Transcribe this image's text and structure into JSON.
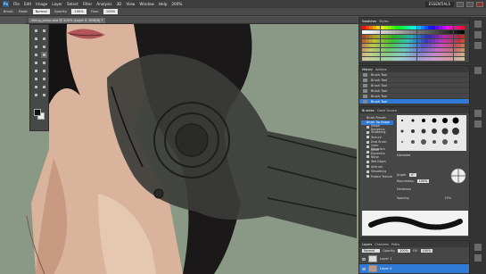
{
  "app": {
    "logo": "Ps",
    "menu": [
      "File",
      "Edit",
      "Image",
      "Layer",
      "Select",
      "Filter",
      "Analysis",
      "3D",
      "View",
      "Window",
      "Help"
    ],
    "workspace": "ESSENTIALS",
    "zoom": "200%"
  },
  "options": {
    "tool_label": "Brush:",
    "mode_label": "Mode:",
    "mode_value": "Normal",
    "opacity_label": "Opacity:",
    "opacity_value": "100%",
    "flow_label": "Flow:",
    "flow_value": "100%"
  },
  "document": {
    "tab_title": "viking_pinup.psd @ 200% (Layer 0, RGB/8) *"
  },
  "panels": {
    "swatches_tabs": [
      "Swatches",
      "Styles"
    ],
    "history_tabs": [
      "History",
      "Actions"
    ],
    "history_items": [
      "Brush Tool",
      "Brush Tool",
      "Brush Tool",
      "Brush Tool",
      "Brush Tool",
      "Brush Tool"
    ],
    "brushes_tabs": [
      "Brushes",
      "Clone Source"
    ],
    "brush_presets_label": "Brush Presets",
    "brush_options": [
      "Brush Tip Shape",
      "Shape Dynamics",
      "Scattering",
      "Texture",
      "Dual Brush",
      "Color Dynamics",
      "Other Dynamics",
      "Noise",
      "Wet Edges",
      "Airbrush",
      "Smoothing",
      "Protect Texture"
    ],
    "brush_diameter_label": "Diameter",
    "brush_angle_label": "Angle:",
    "brush_angle": "0°",
    "brush_roundness_label": "Roundness:",
    "brush_roundness": "100%",
    "brush_hardness_label": "Hardness",
    "brush_spacing_label": "Spacing",
    "brush_spacing": "25%",
    "layers_tabs": [
      "Layers",
      "Channels",
      "Paths"
    ],
    "blend_mode": "Normal",
    "layer_opacity_label": "Opacity:",
    "layer_opacity": "100%",
    "fill_label": "Fill:",
    "fill_value": "100%",
    "layers": [
      "Layer 1",
      "Layer 0"
    ]
  },
  "colors": {
    "selection_blue": "#2f7ad6",
    "canvas_bg": "#8a9886",
    "foreground_color": "#111111",
    "background_color": "#eeeeee"
  }
}
